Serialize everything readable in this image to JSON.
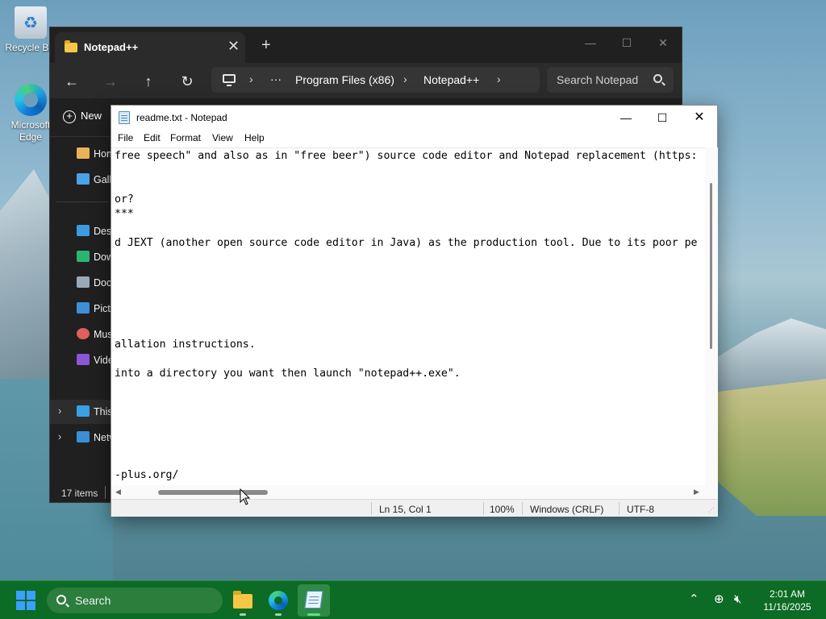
{
  "desktop": {
    "icons": [
      {
        "label": "Recycle Bin"
      },
      {
        "label": "Microsoft Edge"
      }
    ]
  },
  "explorer": {
    "tab_title": "Notepad++",
    "close_tab": "✕",
    "new_tab": "+",
    "breadcrumb": [
      "Program Files (x86)",
      "Notepad++"
    ],
    "ellipsis": "···",
    "search_placeholder": "Search Notepad",
    "new_label": "New",
    "sidebar": [
      {
        "label": "Home",
        "icon": "home-icon"
      },
      {
        "label": "Gallery",
        "icon": "gallery-icon"
      },
      {
        "label": "Desktop",
        "icon": "desktop-icon"
      },
      {
        "label": "Downloads",
        "icon": "downloads-icon"
      },
      {
        "label": "Documents",
        "icon": "documents-icon"
      },
      {
        "label": "Pictures",
        "icon": "pictures-icon"
      },
      {
        "label": "Music",
        "icon": "music-icon"
      },
      {
        "label": "Videos",
        "icon": "videos-icon"
      },
      {
        "label": "This PC",
        "icon": "this-pc-icon"
      },
      {
        "label": "Network",
        "icon": "network-icon"
      }
    ],
    "status": "17 items"
  },
  "notepad": {
    "title": "readme.txt - Notepad",
    "menu": [
      "File",
      "Edit",
      "Format",
      "View",
      "Help"
    ],
    "lines": [
      "free speech\" and also as in \"free beer\") source code editor and Notepad replacement (https:",
      "",
      "",
      "or?",
      "***",
      "",
      "d JEXT (another open source code editor in Java) as the production tool. Due to its poor pe",
      "",
      "",
      "",
      "",
      "",
      "",
      "allation instructions.",
      "",
      "into a directory you want then launch \"notepad++.exe\".",
      "",
      "",
      "",
      "",
      "",
      "",
      "-plus.org/"
    ],
    "status": {
      "position": "Ln 15, Col 1",
      "zoom": "100%",
      "line_ending": "Windows (CRLF)",
      "encoding": "UTF-8"
    }
  },
  "taskbar": {
    "search_placeholder": "Search",
    "time": "2:01 AM",
    "date": "11/16/2025"
  },
  "colors": {
    "taskbar": "#0c6b24",
    "explorer_bg": "#202020",
    "start_accent": "#3aa0ff"
  }
}
